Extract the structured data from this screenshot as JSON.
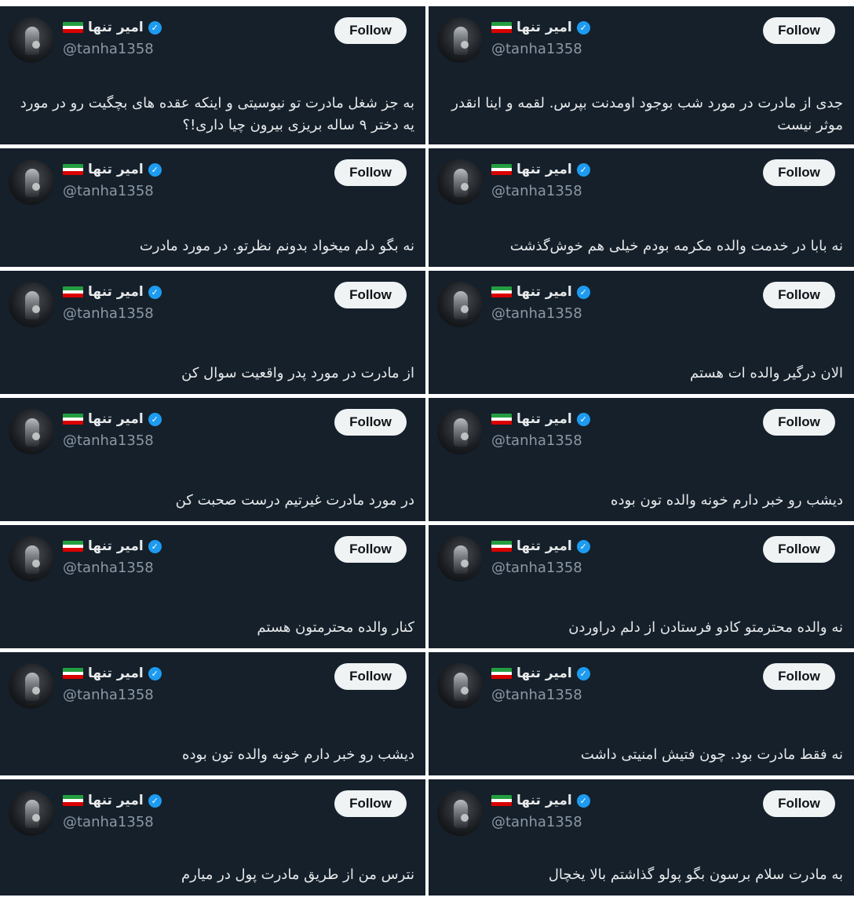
{
  "account": {
    "name": "امیر تنها",
    "handle": "@tanha1358",
    "verified_icon": "verified-badge-icon",
    "flag_icon": "iran-flag-icon",
    "follow_label": "Follow"
  },
  "colors": {
    "card_bg": "#15202b",
    "text": "#e7e9ea",
    "handle": "#8b98a5",
    "verified": "#1d9bf0",
    "follow_bg": "#eff3f4"
  },
  "tweets": [
    {
      "left": "به جز شغل مادرت تو نیوسیتی و اینکه عقده های بچگیت رو در مورد یه دختر ۹ ساله بریزی بیرون چیا داری!؟",
      "right": "جدی از مادرت در مورد شب بوجود اومدنت بپرس. لقمه و اینا انقدر موثر نیست"
    },
    {
      "left": "نه بگو دلم میخواد بدونم نظرتو. در مورد مادرت",
      "right": "نه بابا در خدمت والده مکرمه بودم خیلی هم خوش‌گذشت"
    },
    {
      "left": "از مادرت در مورد پدر واقعیت سوال کن",
      "right": "الان درگیر والده ات هستم"
    },
    {
      "left": "در مورد مادرت غیرتیم درست صحبت کن",
      "right": "دیشب رو خبر دارم خونه والده تون بوده"
    },
    {
      "left": "کنار والده محترمتون هستم",
      "right": "نه والده محترمتو کادو فرستادن از دلم دراوردن"
    },
    {
      "left": "دیشب رو خبر دارم خونه والده تون بوده",
      "right": "نه فقط مادرت بود. چون فتیش امنیتی داشت"
    },
    {
      "left": "نترس من از طریق مادرت پول در میارم",
      "right": "به مادرت سلام برسون بگو پولو گذاشتم بالا یخچال"
    }
  ]
}
